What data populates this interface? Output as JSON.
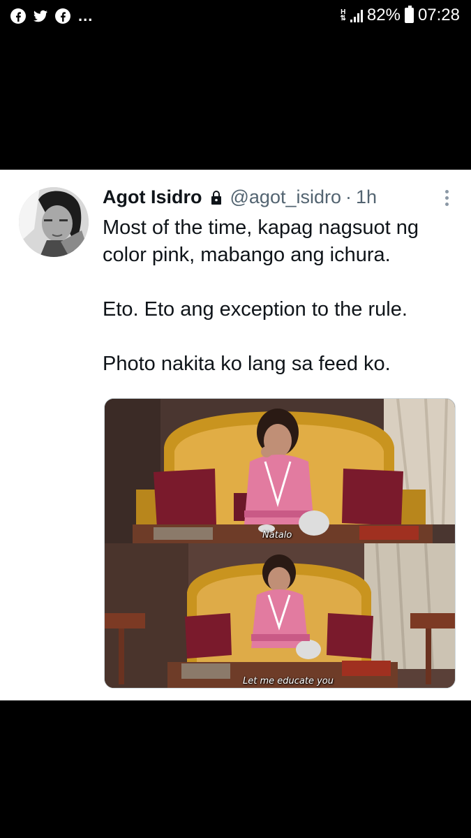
{
  "status_bar": {
    "left_icons": [
      "facebook-icon",
      "twitter-icon",
      "facebook-icon"
    ],
    "more": "...",
    "network": "H",
    "battery_percent": "82%",
    "time": "07:28"
  },
  "tweet": {
    "author_name": "Agot Isidro",
    "handle": "@agot_isidro",
    "separator": "·",
    "time_ago": "1h",
    "text_lines": [
      "Most of the time, kapag nagsuot ng color pink, mabango ang ichura.",
      "Eto. Eto ang exception to the rule.",
      "Photo nakita ko lang sa feed ko."
    ],
    "media": {
      "frames": [
        {
          "caption": "Natalo"
        },
        {
          "caption": "Let me educate you"
        }
      ]
    }
  }
}
